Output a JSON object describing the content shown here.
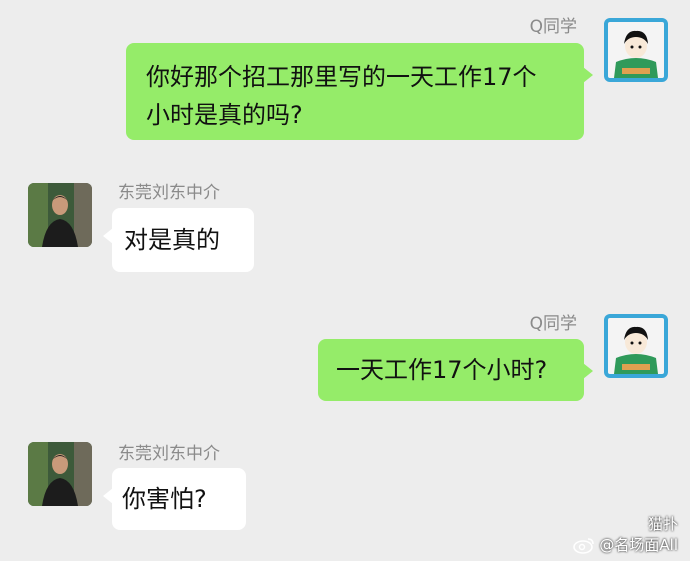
{
  "colors": {
    "background": "#ededed",
    "outgoing_bubble": "#95ec69",
    "incoming_bubble": "#ffffff",
    "name_text": "#8a8a8a"
  },
  "messages": [
    {
      "direction": "outgoing",
      "sender": "Q同学",
      "line1": "你好那个招工那里写的一天工作17个",
      "line2": "小时是真的吗?"
    },
    {
      "direction": "incoming",
      "sender": "东莞刘东中介",
      "text": "对是真的"
    },
    {
      "direction": "outgoing",
      "sender": "Q同学",
      "text": "一天工作17个小时?"
    },
    {
      "direction": "incoming",
      "sender": "东莞刘东中介",
      "text": "你害怕?"
    }
  ],
  "watermark": {
    "line1": "猫扑",
    "line2": "@名场面All",
    "icon": "weibo-icon"
  }
}
